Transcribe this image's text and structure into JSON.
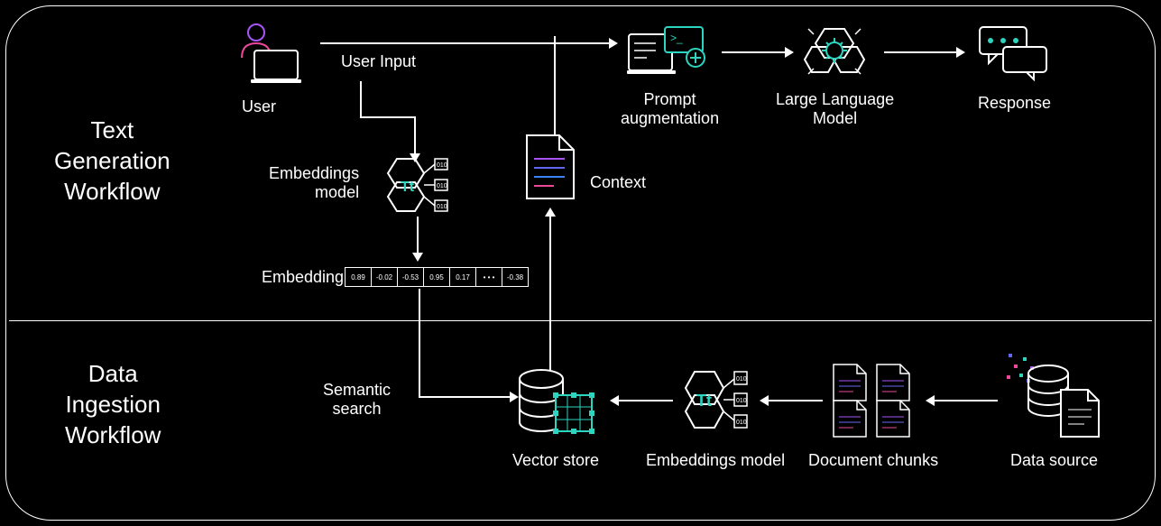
{
  "sections": {
    "text_generation": "Text\nGeneration\nWorkflow",
    "data_ingestion": "Data\nIngestion\nWorkflow"
  },
  "labels": {
    "user": "User",
    "user_input": "User Input",
    "embeddings_model_top": "Embeddings\nmodel",
    "embedding": "Embedding",
    "context": "Context",
    "prompt_aug": "Prompt\naugmentation",
    "llm": "Large Language\nModel",
    "response": "Response",
    "semantic_search": "Semantic\nsearch",
    "vector_store": "Vector store",
    "embeddings_model_bottom": "Embeddings model",
    "doc_chunks": "Document chunks",
    "data_source": "Data source"
  },
  "embedding_values": [
    "0.89",
    "-0.02",
    "-0.53",
    "0.95",
    "0.17",
    "• • •",
    "-0.38"
  ],
  "colors": {
    "accent_teal": "#2dd4bf",
    "accent_purple": "#a855f7",
    "accent_pink": "#ec4899"
  }
}
